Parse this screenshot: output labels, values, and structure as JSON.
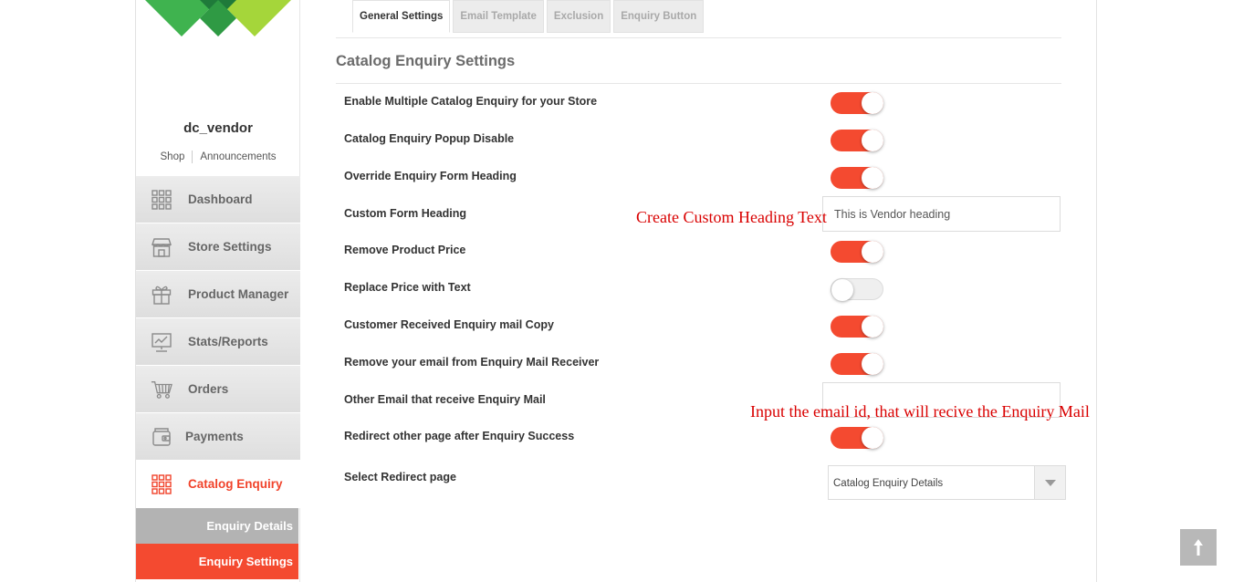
{
  "sidebar": {
    "vendor_name": "dc_vendor",
    "links": [
      "Shop",
      "Announcements"
    ],
    "logo_colors": [
      "#3fb34f",
      "#a5d63a",
      "#1f7a3a"
    ],
    "menu": [
      {
        "label": "Dashboard",
        "icon": "grid-icon"
      },
      {
        "label": "Store Settings",
        "icon": "store-icon"
      },
      {
        "label": "Product Manager",
        "icon": "gift-icon"
      },
      {
        "label": "Stats/Reports",
        "icon": "chart-board-icon"
      },
      {
        "label": "Orders",
        "icon": "cart-icon"
      },
      {
        "label": "Payments",
        "icon": "wallet-icon"
      },
      {
        "label": "Catalog Enquiry",
        "icon": "grid-icon",
        "active": true
      }
    ],
    "submenu": [
      "Enquiry Details",
      "Enquiry Settings"
    ]
  },
  "tabs": [
    {
      "label": "General Settings",
      "active": true
    },
    {
      "label": "Email Template"
    },
    {
      "label": "Exclusion"
    },
    {
      "label": "Enquiry Button"
    }
  ],
  "section_title": "Catalog Enquiry Settings",
  "settings": [
    {
      "label": "Enable Multiple Catalog Enquiry for your Store",
      "type": "toggle",
      "on": true
    },
    {
      "label": "Catalog Enquiry Popup Disable",
      "type": "toggle",
      "on": true
    },
    {
      "label": "Override Enquiry Form Heading",
      "type": "toggle",
      "on": true
    },
    {
      "label": "Custom Form Heading",
      "type": "text",
      "value": "This is Vendor heading"
    },
    {
      "label": "Remove Product Price",
      "type": "toggle",
      "on": true
    },
    {
      "label": "Replace Price with Text",
      "type": "toggle",
      "on": false
    },
    {
      "label": "Customer Received Enquiry mail Copy",
      "type": "toggle",
      "on": true
    },
    {
      "label": "Remove your email from Enquiry Mail Receiver",
      "type": "toggle",
      "on": true
    },
    {
      "label": "Other Email that receive Enquiry Mail",
      "type": "text",
      "value": ""
    },
    {
      "label": "Redirect other page after Enquiry Success",
      "type": "toggle",
      "on": true
    },
    {
      "label": "Select Redirect page",
      "type": "select",
      "value": "Catalog Enquiry Details"
    }
  ],
  "annotations": {
    "heading": "Create Custom Heading Text",
    "email": "Input the email id, that will recive the Enquiry Mail"
  },
  "colors": {
    "accent": "#f44a30",
    "menu_bg": "#e5e5e5",
    "submenu_grey": "#b3b3b3",
    "annotation": "#d90000"
  }
}
